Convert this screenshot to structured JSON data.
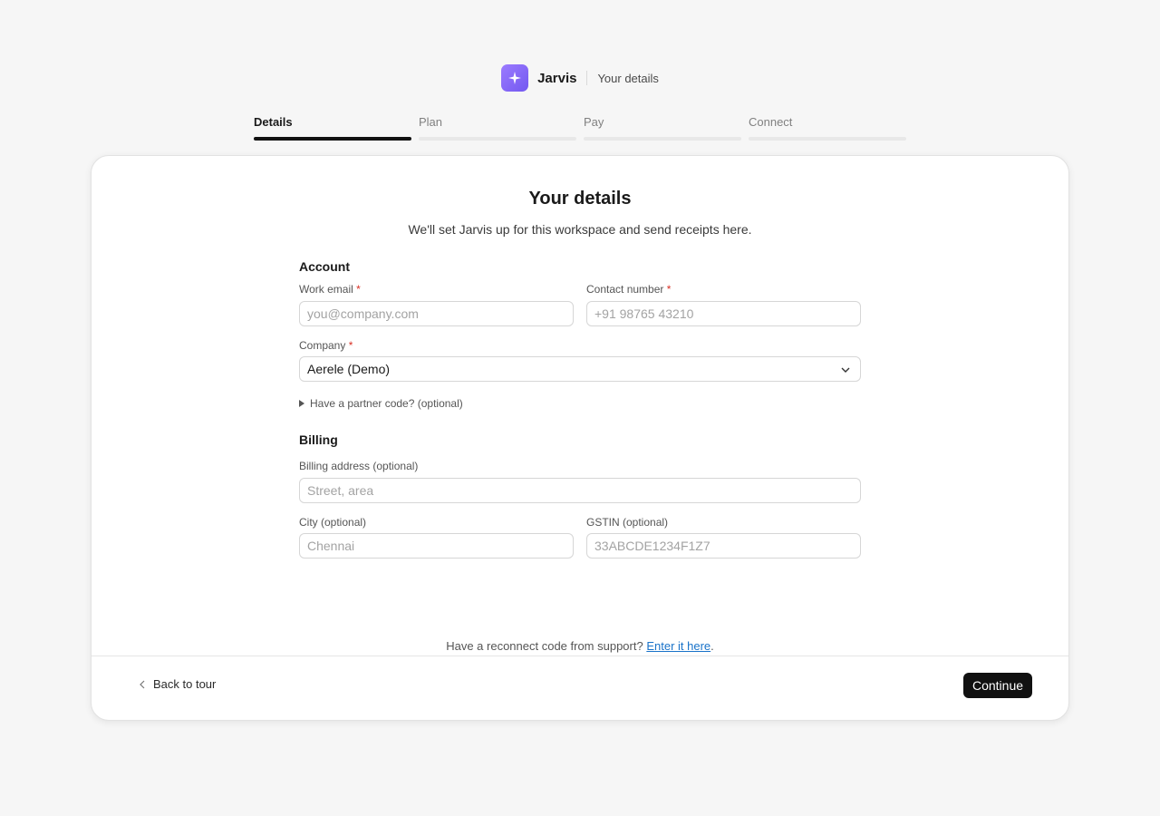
{
  "header": {
    "brand": "Jarvis",
    "breadcrumb": "Your details",
    "logo_icon": "sparkle-icon",
    "logo_color": "#7f63f5"
  },
  "steps": [
    {
      "label": "Details",
      "active": true
    },
    {
      "label": "Plan",
      "active": false
    },
    {
      "label": "Pay",
      "active": false
    },
    {
      "label": "Connect",
      "active": false
    }
  ],
  "page": {
    "title": "Your details",
    "subtitle": "We'll set Jarvis up for this workspace and send receipts here."
  },
  "account": {
    "heading": "Account",
    "work_email_label": "Work email",
    "work_email_placeholder": "you@company.com",
    "contact_label": "Contact number",
    "contact_placeholder": "+91 98765 43210",
    "company_label": "Company",
    "company_value": "Aerele (Demo)",
    "partner_toggle": "Have a partner code? (optional)",
    "required_mark": "*"
  },
  "billing": {
    "heading": "Billing",
    "address_label": "Billing address (optional)",
    "address_placeholder": "Street, area",
    "city_label": "City (optional)",
    "city_placeholder": "Chennai",
    "gstin_label": "GSTIN (optional)",
    "gstin_placeholder": "33ABCDE1234F1Z7"
  },
  "footer": {
    "reconnect_text": "Have a reconnect code from support?",
    "reconnect_link": "Enter it here",
    "reconnect_end": ".",
    "back_label": "Back to tour",
    "continue_label": "Continue"
  }
}
